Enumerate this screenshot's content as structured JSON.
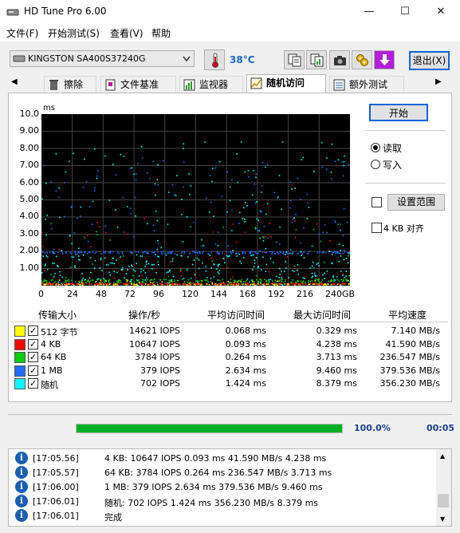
{
  "window": {
    "title": "HD Tune Pro 6.00",
    "minimize": "—",
    "maximize": "☐",
    "close": "✕"
  },
  "menu": [
    "文件(F)",
    "开始测试(S)",
    "查看(V)",
    "帮助"
  ],
  "toolbar": {
    "drive": "KINGSTON SA400S37240G",
    "temperature": "38°C",
    "temp_color": "#1a66c8",
    "exit_label": "退出(X)"
  },
  "tabs": [
    {
      "label": "擦除",
      "icon": "trash-icon"
    },
    {
      "label": "文件基准",
      "icon": "file-benchmark-icon"
    },
    {
      "label": "监视器",
      "icon": "monitor-icon"
    },
    {
      "label": "随机访问",
      "icon": "random-access-icon",
      "active": true
    },
    {
      "label": "额外测试",
      "icon": "extra-tests-icon"
    }
  ],
  "controls": {
    "start_label": "开始",
    "read_label": "读取",
    "write_label": "写入",
    "range_label": "设置范围",
    "align_label": "4 KB 对齐"
  },
  "chart_data": {
    "type": "scatter",
    "yunit": "ms",
    "xunit": "GB",
    "yticks": [
      "10.0",
      "9.00",
      "8.00",
      "7.00",
      "6.00",
      "5.00",
      "4.00",
      "3.00",
      "2.00",
      "1.00"
    ],
    "xticks": [
      "0",
      "24",
      "48",
      "72",
      "96",
      "120",
      "144",
      "168",
      "192",
      "216",
      "240GB"
    ],
    "xlim": [
      0,
      240
    ],
    "ylim": [
      0,
      10
    ],
    "grid": true,
    "series": [
      {
        "name": "512 字节",
        "color": "#ffff00",
        "typical_ms": 0.068,
        "max_ms": 0.329
      },
      {
        "name": "4 KB",
        "color": "#ff0000",
        "typical_ms": 0.093,
        "max_ms": 4.238
      },
      {
        "name": "64 KB",
        "color": "#00cc00",
        "typical_ms": 0.264,
        "max_ms": 3.713
      },
      {
        "name": "1 MB",
        "color": "#1e6cff",
        "typical_ms": 2.634,
        "max_ms": 9.46
      },
      {
        "name": "随机",
        "color": "#00ffff",
        "typical_ms": 1.424,
        "max_ms": 8.379
      }
    ]
  },
  "table": {
    "headers": [
      "传输大小",
      "操作/秒",
      "平均访问时间",
      "最大访问时间",
      "平均速度"
    ],
    "rows": [
      {
        "label": "512 字节",
        "iops": "14621 IOPS",
        "avg": "0.068 ms",
        "max": "0.329 ms",
        "speed": "7.140 MB/s"
      },
      {
        "label": "4 KB",
        "iops": "10647 IOPS",
        "avg": "0.093 ms",
        "max": "4.238 ms",
        "speed": "41.590 MB/s"
      },
      {
        "label": "64 KB",
        "iops": "3784 IOPS",
        "avg": "0.264 ms",
        "max": "3.713 ms",
        "speed": "236.547 MB/s"
      },
      {
        "label": "1 MB",
        "iops": "379 IOPS",
        "avg": "2.634 ms",
        "max": "9.460 ms",
        "speed": "379.536 MB/s"
      },
      {
        "label": "随机",
        "iops": "702 IOPS",
        "avg": "1.424 ms",
        "max": "8.379 ms",
        "speed": "356.230 MB/s"
      }
    ]
  },
  "progress": {
    "percent_label": "100.0%",
    "fraction": 1.0,
    "time": "00:05"
  },
  "log": [
    {
      "time": "[17:05.56]",
      "msg": "4 KB: 10647 IOPS 0.093 ms 41.590 MB/s 4.238 ms"
    },
    {
      "time": "[17:05.57]",
      "msg": "64 KB: 3784 IOPS 0.264 ms 236.547 MB/s 3.713 ms"
    },
    {
      "time": "[17:06.00]",
      "msg": "1 MB: 379 IOPS 2.634 ms 379.536 MB/s 9.460 ms"
    },
    {
      "time": "[17:06.01]",
      "msg": "随机: 702 IOPS 1.424 ms 356.230 MB/s 8.379 ms"
    },
    {
      "time": "[17:06.01]",
      "msg": "完成"
    }
  ]
}
